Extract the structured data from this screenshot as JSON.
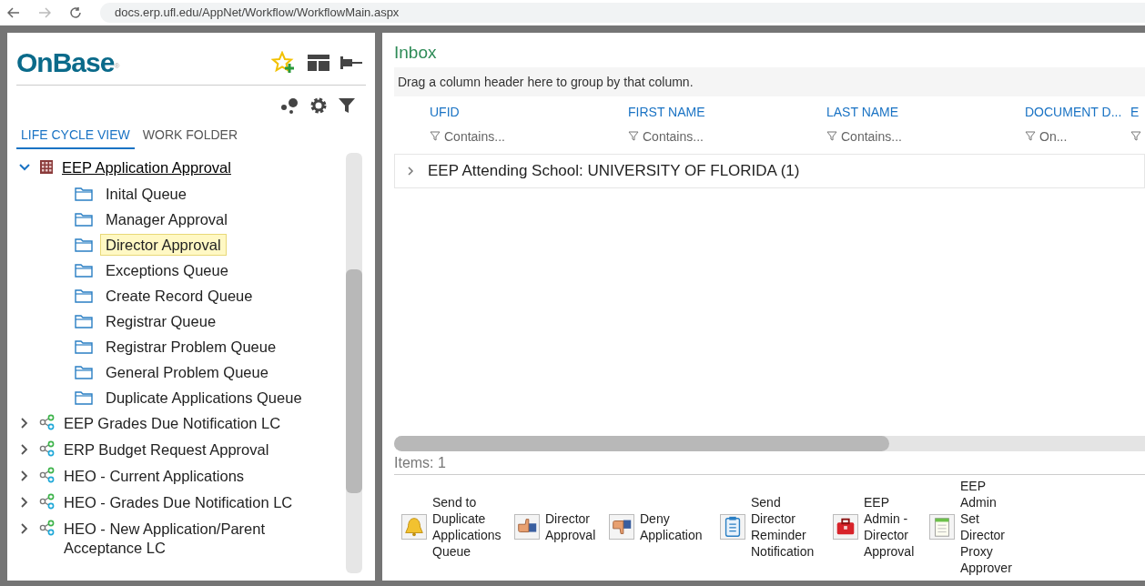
{
  "browser": {
    "url": "docs.erp.ufl.edu/AppNet/Workflow/WorkflowMain.aspx"
  },
  "logo": {
    "text": "OnBase",
    "mark": "®"
  },
  "tabs": [
    {
      "label": "LIFE CYCLE VIEW",
      "selected": true
    },
    {
      "label": "WORK FOLDER",
      "selected": false
    }
  ],
  "tree": [
    {
      "label": "EEP Application Approval",
      "kind": "lifecycle-building",
      "expanded": true,
      "children": [
        {
          "label": "Inital Queue",
          "selected": false
        },
        {
          "label": "Manager Approval",
          "selected": false
        },
        {
          "label": "Director Approval",
          "selected": true
        },
        {
          "label": "Exceptions Queue",
          "selected": false
        },
        {
          "label": "Create Record Queue",
          "selected": false
        },
        {
          "label": "Registrar Queue",
          "selected": false
        },
        {
          "label": "Registrar Problem Queue",
          "selected": false
        },
        {
          "label": "General Problem Queue",
          "selected": false
        },
        {
          "label": "Duplicate Applications Queue",
          "selected": false
        }
      ]
    },
    {
      "label": "EEP Grades Due Notification LC",
      "kind": "lifecycle",
      "expanded": false
    },
    {
      "label": "ERP Budget Request Approval",
      "kind": "lifecycle",
      "expanded": false
    },
    {
      "label": "HEO - Current Applications",
      "kind": "lifecycle",
      "expanded": false
    },
    {
      "label": "HEO - Grades Due Notification LC",
      "kind": "lifecycle",
      "expanded": false
    },
    {
      "label": "HEO - New Application/Parent Acceptance LC",
      "kind": "lifecycle",
      "expanded": false
    }
  ],
  "inbox": {
    "title": "Inbox",
    "group_hint": "Drag a column header here to group by that column.",
    "columns": [
      {
        "label": "UFID",
        "filter": "Contains..."
      },
      {
        "label": "FIRST NAME",
        "filter": "Contains..."
      },
      {
        "label": "LAST NAME",
        "filter": "Contains..."
      },
      {
        "label": "DOCUMENT D...",
        "filter": "On..."
      },
      {
        "label": "E"
      }
    ],
    "group_row": "EEP Attending School: UNIVERSITY OF FLORIDA (1)",
    "items": "Items: 1"
  },
  "tasks": [
    {
      "label": "Send to Duplicate Applications Queue",
      "kind": "bell"
    },
    {
      "label": "Director Approval",
      "kind": "thumbs-up"
    },
    {
      "label": "Deny Application",
      "kind": "thumbs-down"
    },
    {
      "label": "Send Director Reminder Notification",
      "kind": "clipboard"
    },
    {
      "label": "EEP Admin - Director Approval",
      "kind": "toolbox"
    },
    {
      "label": "EEP Admin Set Director Proxy Approver",
      "kind": "notepad"
    }
  ]
}
